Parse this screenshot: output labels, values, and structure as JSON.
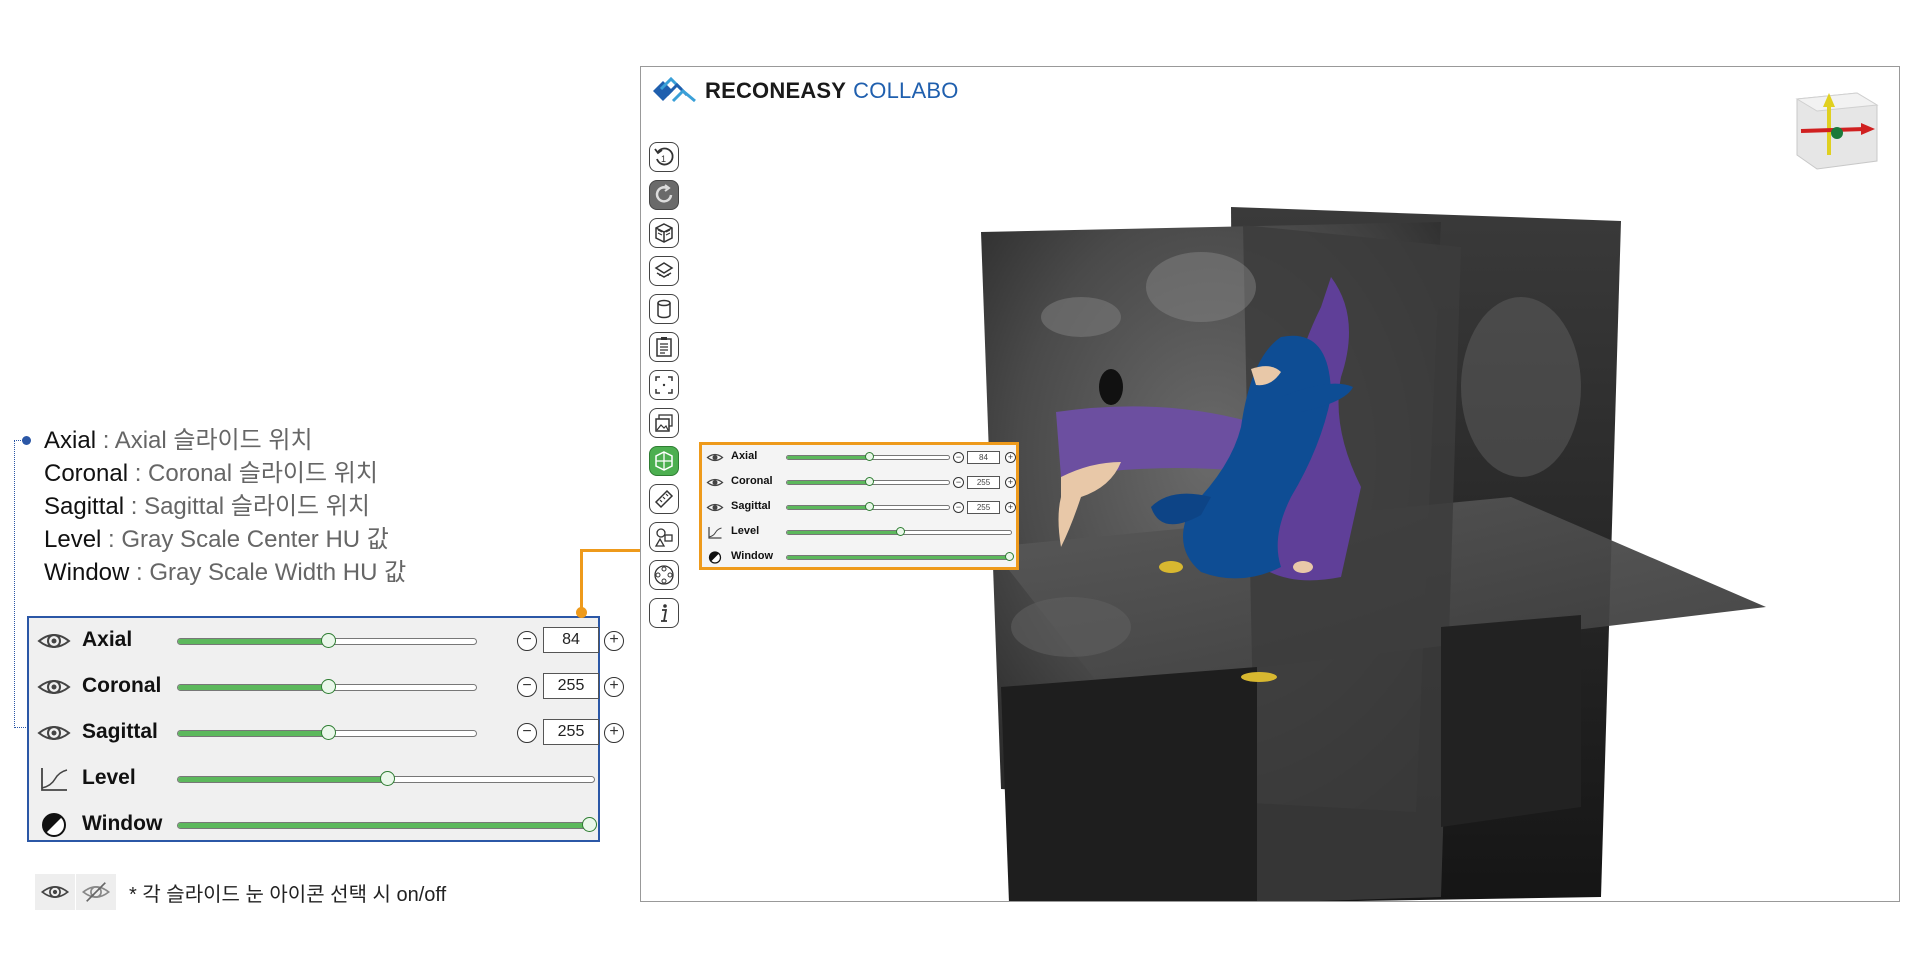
{
  "annotation": {
    "items": [
      {
        "key": "Axial",
        "desc": " : Axial 슬라이드 위치"
      },
      {
        "key": "Coronal",
        "desc": " : Coronal 슬라이드 위치"
      },
      {
        "key": "Sagittal",
        "desc": " : Sagittal 슬라이드 위치"
      },
      {
        "key": "Level",
        "desc": " : Gray Scale Center HU 값"
      },
      {
        "key": "Window",
        "desc": " : Gray Scale Width HU 값"
      }
    ],
    "hint": "* 각 슬라이드 눈 아이콘 선택 시 on/off",
    "hint_icons": [
      "eye-icon",
      "eye-off-icon"
    ]
  },
  "panel": {
    "rows": [
      {
        "label": "Axial",
        "icon": "eye-icon",
        "value": "84",
        "slider": 0.5,
        "has_stepper": true
      },
      {
        "label": "Coronal",
        "icon": "eye-icon",
        "value": "255",
        "slider": 0.5,
        "has_stepper": true
      },
      {
        "label": "Sagittal",
        "icon": "eye-icon",
        "value": "255",
        "slider": 0.5,
        "has_stepper": true
      },
      {
        "label": "Level",
        "icon": "level-curve-icon",
        "slider": 0.5,
        "has_stepper": false
      },
      {
        "label": "Window",
        "icon": "contrast-icon",
        "slider": 1.0,
        "has_stepper": false
      }
    ]
  },
  "app": {
    "brand_bold": "RECONEASY",
    "brand_light": "COLLABO",
    "brand_color": "#1f5fae",
    "tools": [
      "reset-view-icon",
      "rotate-icon",
      "cube-view-icon",
      "layers-settings-icon",
      "cylinder-icon",
      "report-icon",
      "fit-frame-icon",
      "image-gallery-icon",
      "slice-planes-icon",
      "ruler-icon",
      "shapes-icon",
      "navigation-icon",
      "info-icon"
    ],
    "active_tool_index": 8,
    "pressed_tool_index": 1
  },
  "colors": {
    "panel_border_big": "#2b57a6",
    "panel_border_small": "#ee9a1b",
    "slider_fill": "#5cb85c"
  }
}
